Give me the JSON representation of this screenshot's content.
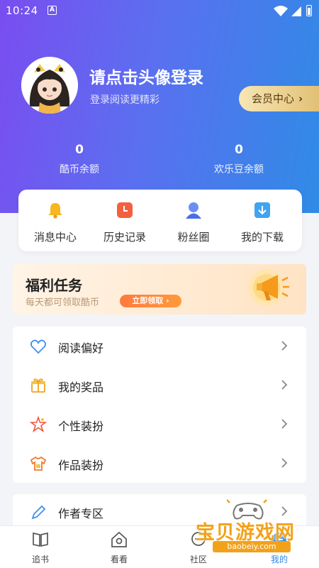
{
  "status_bar": {
    "time": "10:24",
    "a_badge": "A"
  },
  "profile": {
    "title": "请点击头像登录",
    "subtitle": "登录阅读更精彩",
    "vip_button": "会员中心",
    "vip_chevron": "›"
  },
  "stats": [
    {
      "value": "0",
      "label": "酷币余额"
    },
    {
      "value": "0",
      "label": "欢乐豆余额"
    }
  ],
  "quick_actions": [
    {
      "label": "消息中心",
      "icon": "bell-icon"
    },
    {
      "label": "历史记录",
      "icon": "history-icon"
    },
    {
      "label": "粉丝圈",
      "icon": "fans-icon"
    },
    {
      "label": "我的下载",
      "icon": "download-icon"
    }
  ],
  "welfare": {
    "title": "福利任务",
    "subtitle": "每天都可领取酷币",
    "button": "立即领取 ›"
  },
  "menu": [
    {
      "label": "阅读偏好",
      "icon": "heart-icon"
    },
    {
      "label": "我的奖品",
      "icon": "gift-icon"
    },
    {
      "label": "个性装扮",
      "icon": "star-icon"
    },
    {
      "label": "作品装扮",
      "icon": "shirt-icon"
    }
  ],
  "menu2": [
    {
      "label": "作者专区",
      "icon": "pen-icon"
    }
  ],
  "tabbar": [
    {
      "label": "追书",
      "icon": "book-icon"
    },
    {
      "label": "看看",
      "icon": "home-icon"
    },
    {
      "label": "社区",
      "icon": "community-icon"
    },
    {
      "label": "我的",
      "icon": "profile-icon"
    }
  ],
  "watermark": {
    "text": "宝贝游戏网",
    "url": "baobeiy.com"
  },
  "colors": {
    "hero_start": "#7a4df0",
    "hero_end": "#2f8be6",
    "vip_gold": "#e0be72",
    "orange": "#ff7a3d",
    "accent_blue": "#2f86e8"
  }
}
